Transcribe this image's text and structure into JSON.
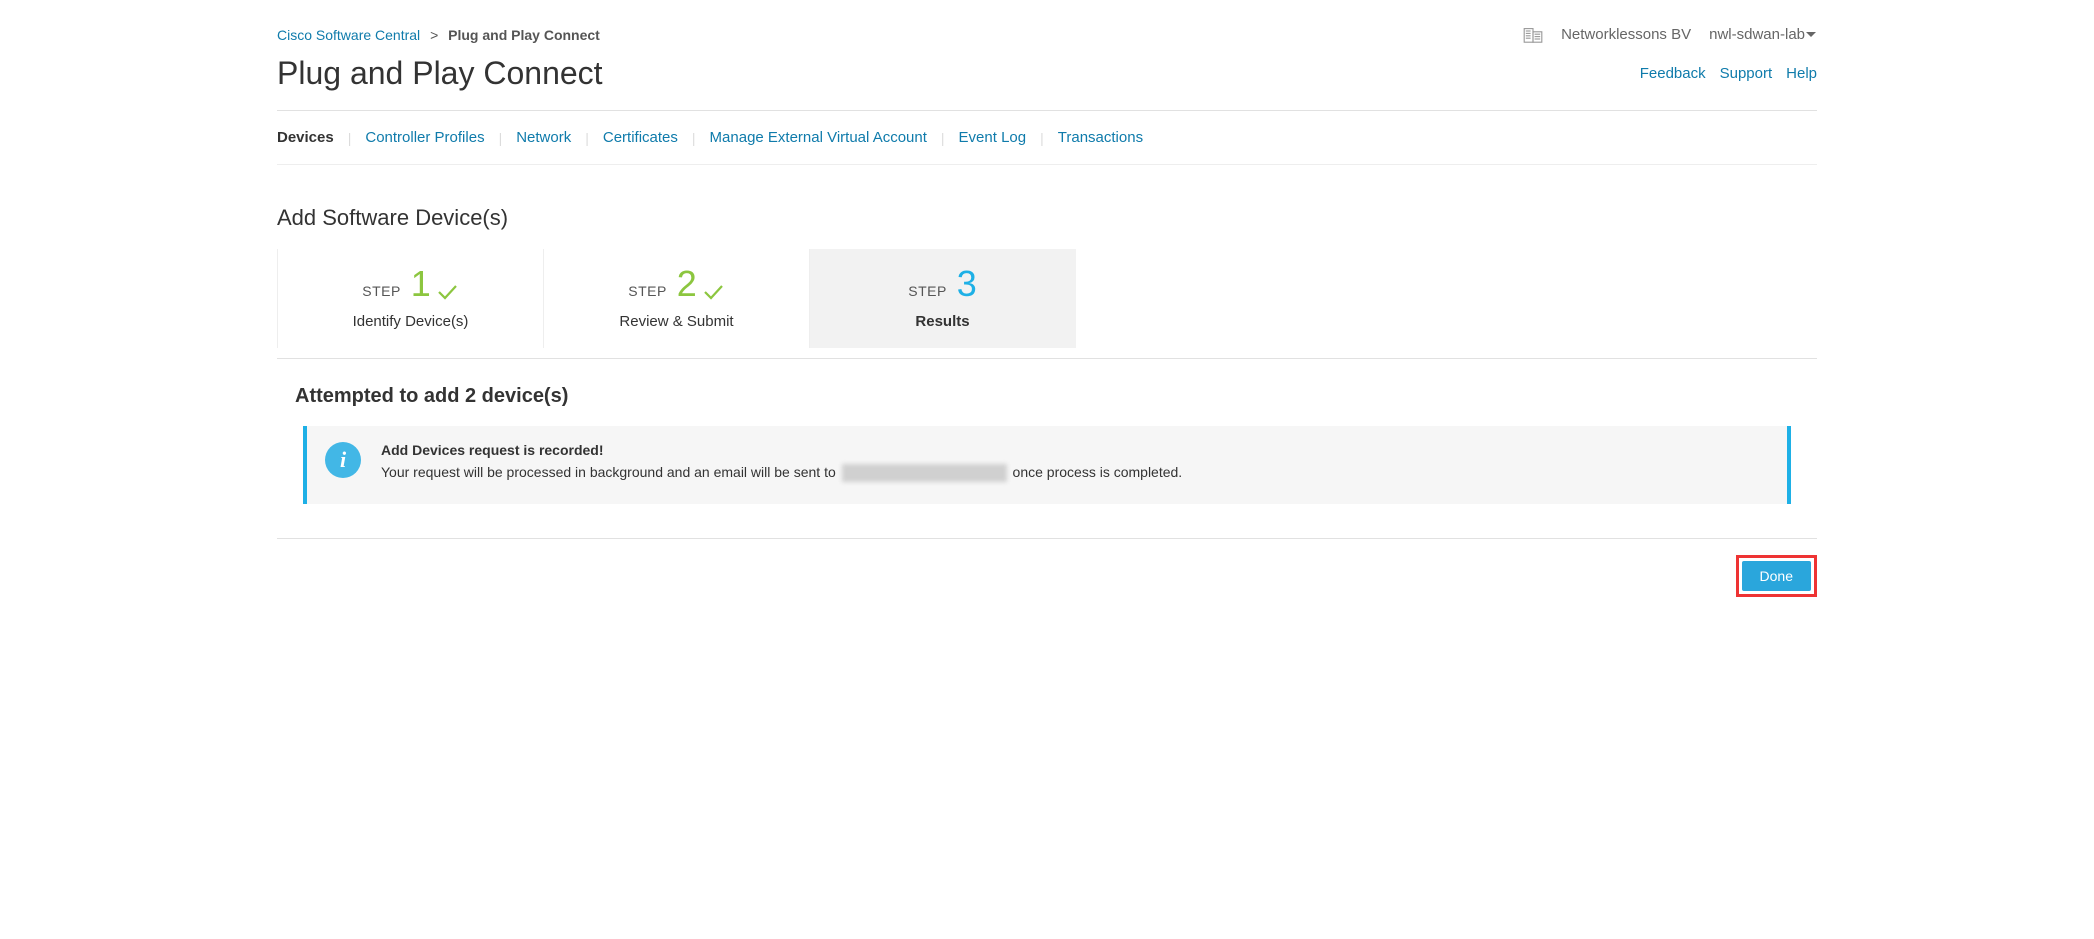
{
  "breadcrumb": {
    "root": "Cisco Software Central",
    "sep": ">",
    "current": "Plug and Play Connect"
  },
  "account": {
    "org": "Networklessons BV",
    "lab": "nwl-sdwan-lab"
  },
  "page_title": "Plug and Play Connect",
  "help_links": {
    "feedback": "Feedback",
    "support": "Support",
    "help": "Help"
  },
  "tabs": {
    "devices": "Devices",
    "controller_profiles": "Controller Profiles",
    "network": "Network",
    "certificates": "Certificates",
    "mgmt_virtual_account": "Manage External Virtual Account",
    "event_log": "Event Log",
    "transactions": "Transactions"
  },
  "section_title": "Add Software Device(s)",
  "steps": {
    "word_step": "STEP",
    "s1": {
      "num": "1",
      "caption": "Identify Device(s)"
    },
    "s2": {
      "num": "2",
      "caption": "Review & Submit"
    },
    "s3": {
      "num": "3",
      "caption": "Results"
    }
  },
  "result": {
    "title": "Attempted to add 2 device(s)",
    "info_headline": "Add Devices request is recorded!",
    "info_pre": "Your request will be processed in background and an email will be sent to ",
    "info_post": " once process is completed."
  },
  "buttons": {
    "done": "Done"
  }
}
